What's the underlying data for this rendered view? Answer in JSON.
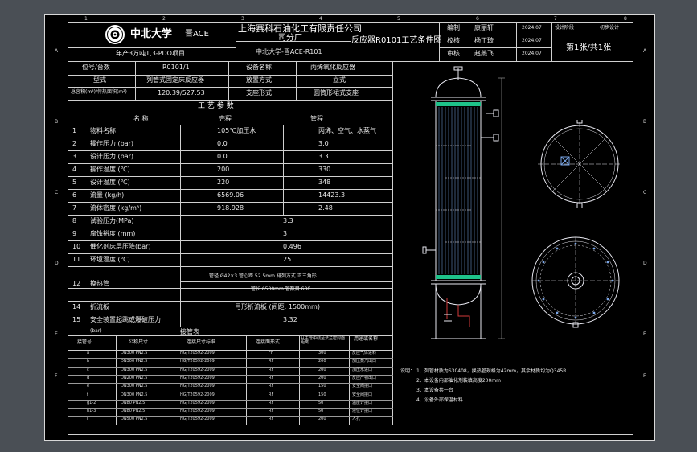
{
  "border": {
    "top_numbers": [
      "1",
      "2",
      "3",
      "4",
      "5",
      "6",
      "7",
      "8"
    ],
    "side_letters": [
      "A",
      "B",
      "C",
      "D",
      "E",
      "F"
    ]
  },
  "title_block": {
    "university": "中北大学",
    "author_code": "晋ACE",
    "company": "上海赛科石油化工有限责任公司",
    "company_sub": "司分厂",
    "project": "年产3万吨1,3-PDO项目",
    "drawing_code": "中北大学-晋ACE-R101",
    "drawing_title": "反应器R0101工艺条件图",
    "rows": [
      {
        "role": "编制",
        "name": "康丽轩",
        "date": "2024.07",
        "stage_label": "设计阶段",
        "stage": "初步设计"
      },
      {
        "role": "校核",
        "name": "杨丁琦",
        "date": "2024.07"
      },
      {
        "role": "审核",
        "name": "赵燕飞",
        "date": "2024.07"
      }
    ],
    "sheet": "第1张/共1张"
  },
  "spec": {
    "r1": {
      "l1": "位号/台数",
      "v1": "R0101/1",
      "l2": "设备名称",
      "v2": "丙烯氧化反应器"
    },
    "r2": {
      "l1": "型式",
      "v1": "列管式固定床反应器",
      "l2": "放置方式",
      "v2": "立式"
    },
    "r3": {
      "l1": "总容积(m³)/传热面积(m²)",
      "v1": "120.39/527.53",
      "l2": "支座形式",
      "v2": "圆筒形裙式支座"
    },
    "header": "工 艺 参 数",
    "col_item": "名 称",
    "col_shell": "壳程",
    "col_tube": "管程",
    "params": [
      {
        "n": "1",
        "name": "物料名称",
        "shell": "105℃加压水",
        "tube": "丙烯、空气、水蒸气"
      },
      {
        "n": "2",
        "name": "操作压力 (bar)",
        "shell": "0.0",
        "tube": "3.0"
      },
      {
        "n": "3",
        "name": "设计压力 (bar)",
        "shell": "0.0",
        "tube": "3.3"
      },
      {
        "n": "4",
        "name": "操作温度 (℃)",
        "shell": "200",
        "tube": "330"
      },
      {
        "n": "5",
        "name": "设计温度 (℃)",
        "shell": "220",
        "tube": "348"
      },
      {
        "n": "6",
        "name": "流量 (kg/h)",
        "shell": "6569.06",
        "tube": "14423.3"
      },
      {
        "n": "7",
        "name": "流体密度 (kg/m³)",
        "shell": "918.928",
        "tube": "2.48"
      },
      {
        "n": "8",
        "name": "试验压力(MPa)",
        "merged": "3.3"
      },
      {
        "n": "9",
        "name": "腐蚀裕度 (mm)",
        "merged": "3"
      },
      {
        "n": "10",
        "name": "催化剂床层压降(bar)",
        "merged": "0.496"
      },
      {
        "n": "11",
        "name": "环境温度 (℃)",
        "merged": "25"
      }
    ],
    "tube_row": {
      "n": "12",
      "name": "换热管",
      "line1": "管径 Ø42×3   管心距 52.5mm   排列方式 正三角形",
      "line2": "管长 6500mm   管数目 600"
    },
    "row14": {
      "n": "14",
      "name": "折流板",
      "value": "弓形折流板 (间距: 1500mm)"
    },
    "row15": {
      "n": "15",
      "name": "安全装置起跳或爆破压力",
      "value": "3.32"
    },
    "bar_unit": "(bar)",
    "nozzle_title": "接管表"
  },
  "nozzles": {
    "headers": [
      "接管号",
      "公称尺寸",
      "连接尺寸标准",
      "连接面形式",
      "从主管中线至法兰密封面距离",
      "用途或名称"
    ],
    "headers_short": [
      "接管号",
      "公称尺寸",
      "连接尺寸标准",
      "连接面形式",
      "从主管中线距离",
      "用途或名称"
    ],
    "first_purpose": "反应气体进料",
    "rows": [
      {
        "id": "a",
        "dn": "DN300 PN2.5",
        "std": "HG/T20592-2009",
        "face": "FF",
        "dist": "300",
        "use": "反应气体进料"
      },
      {
        "id": "b",
        "dn": "DN300 PN2.5",
        "std": "HG/T20592-2009",
        "face": "RF",
        "dist": "200",
        "use": "加压蒸汽出口"
      },
      {
        "id": "c",
        "dn": "DN300 PN2.5",
        "std": "HG/T20592-2009",
        "face": "RF",
        "dist": "200",
        "use": "加压水进口"
      },
      {
        "id": "d",
        "dn": "DN200 PN2.5",
        "std": "HG/T20592-2009",
        "face": "RF",
        "dist": "200",
        "use": "反应产物出口"
      },
      {
        "id": "e",
        "dn": "DN300 PN2.5",
        "std": "HG/T20592-2009",
        "face": "RF",
        "dist": "150",
        "use": "安全阀接口"
      },
      {
        "id": "f",
        "dn": "DN300 PN2.5",
        "std": "HG/T20592-2009",
        "face": "RF",
        "dist": "150",
        "use": "安全阀接口"
      },
      {
        "id": "g1-2",
        "dn": "DN80 PN2.5",
        "std": "HG/T20592-2009",
        "face": "RF",
        "dist": "50",
        "use": "温度计接口"
      },
      {
        "id": "h1-3",
        "dn": "DN80 PN2.5",
        "std": "HG/T20592-2009",
        "face": "RF",
        "dist": "50",
        "use": "液位计接口"
      },
      {
        "id": "i",
        "dn": "DN500 PN2.5",
        "std": "HG/T20592-2009",
        "face": "RF",
        "dist": "200",
        "use": "人孔"
      }
    ]
  },
  "notes": {
    "title": "说明：",
    "lines": [
      "1、列管材质为S30408，换热管规格为42mm，其余材质均为Q345R",
      "2、本设备内部催化剂装填高度200mm",
      "3、本设备共一台",
      "4、设备外部保温材料"
    ]
  },
  "colors": {
    "background": "#4a4f55",
    "paper": "#000000",
    "line": "#d0d0d0",
    "tube_green": "#1ec28a",
    "tube_blue": "#7aa6e8",
    "vessel": "#e8e8f0",
    "accent_red": "#d23a3a"
  },
  "icons": {
    "logo": "university-seal-icon"
  }
}
